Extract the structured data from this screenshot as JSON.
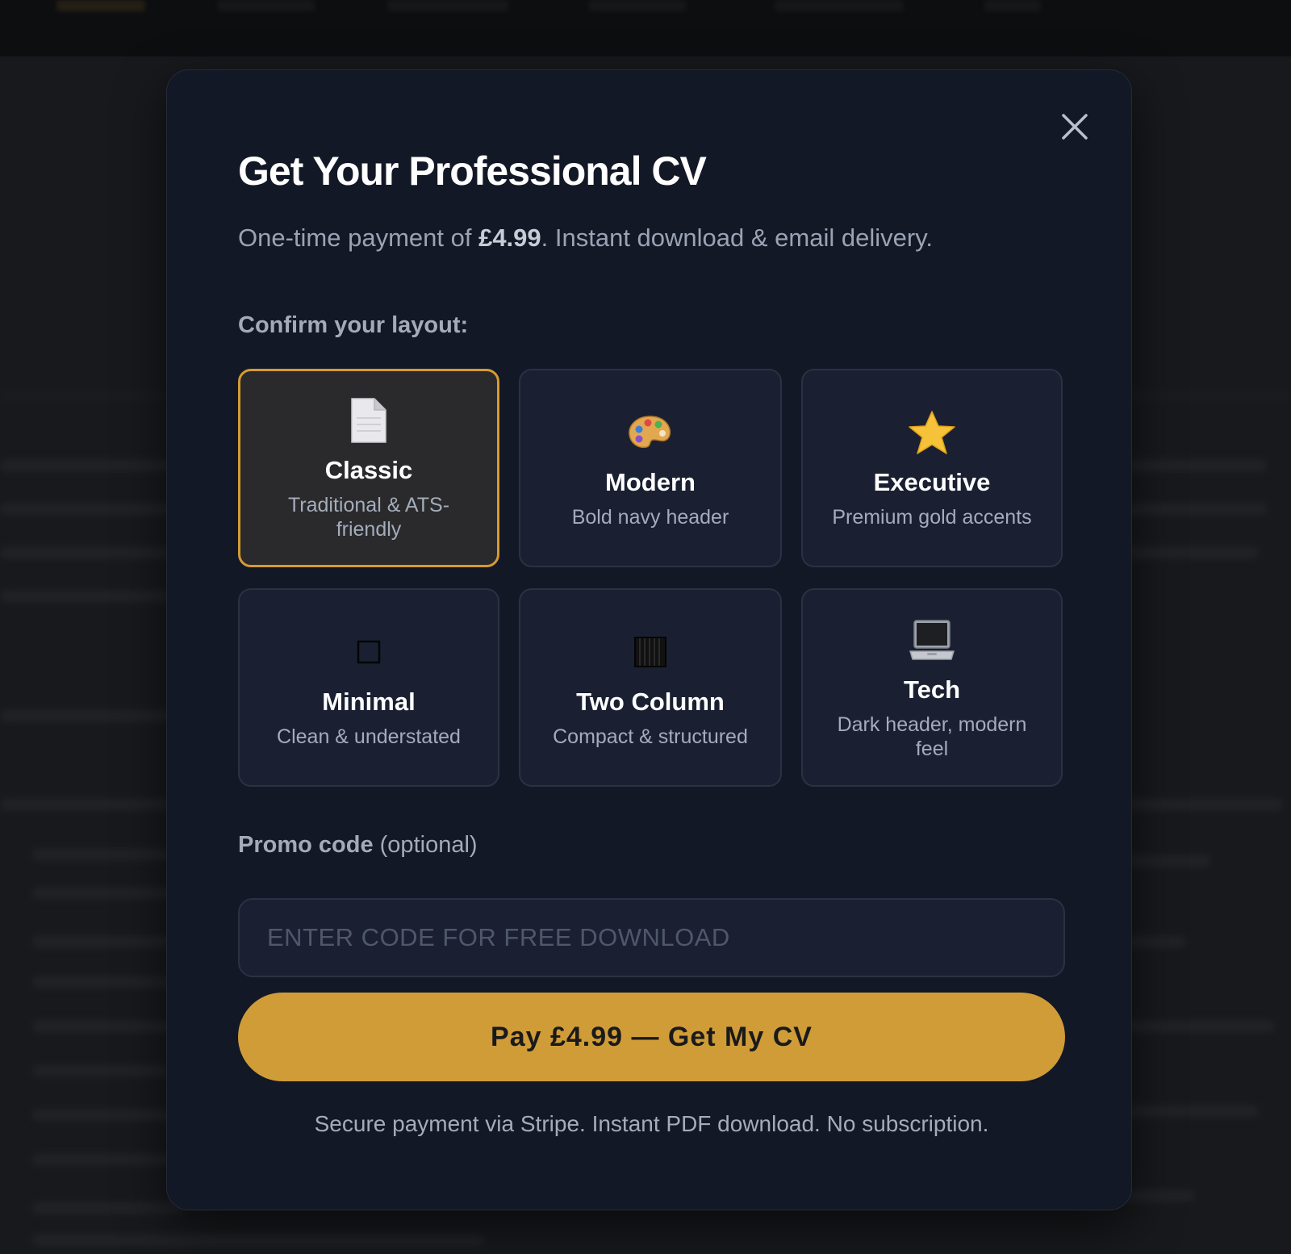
{
  "modal": {
    "title": "Get Your Professional CV",
    "subtitle_prefix": "One-time payment of ",
    "subtitle_price": "£4.99",
    "subtitle_suffix": ". Instant download & email delivery.",
    "layout_label": "Confirm your layout:",
    "close_icon": "close-icon"
  },
  "layouts": [
    {
      "name": "Classic",
      "desc": "Traditional & ATS-friendly",
      "icon": "page-icon",
      "selected": true
    },
    {
      "name": "Modern",
      "desc": "Bold navy header",
      "icon": "palette-icon",
      "selected": false
    },
    {
      "name": "Executive",
      "desc": "Premium gold accents",
      "icon": "star-icon",
      "selected": false
    },
    {
      "name": "Minimal",
      "desc": "Clean & understated",
      "icon": "square-outline-icon",
      "selected": false
    },
    {
      "name": "Two Column",
      "desc": "Compact & structured",
      "icon": "columns-icon",
      "selected": false
    },
    {
      "name": "Tech",
      "desc": "Dark header, modern feel",
      "icon": "laptop-icon",
      "selected": false
    }
  ],
  "promo": {
    "label_bold": "Promo code",
    "label_rest": " (optional)",
    "placeholder": "ENTER CODE FOR FREE DOWNLOAD",
    "value": ""
  },
  "pay_button": "Pay £4.99 — Get My CV",
  "footnote": "Secure payment via Stripe. Instant PDF download. No subscription.",
  "colors": {
    "accent": "#d09c38",
    "modal_bg": "#131826",
    "card_bg": "#1a2031"
  }
}
